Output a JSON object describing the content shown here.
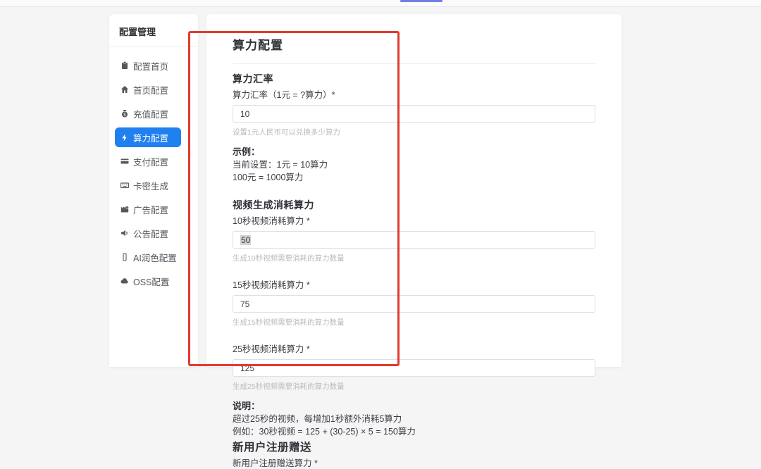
{
  "topbar": {
    "accent_color": "#7280e4"
  },
  "sidebar": {
    "title": "配置管理",
    "active_color": "#2080f0",
    "items": [
      {
        "icon": "clipboard-icon",
        "label": "配置首页",
        "active": false
      },
      {
        "icon": "home-icon",
        "label": "首页配置",
        "active": false
      },
      {
        "icon": "coin-icon",
        "label": "充值配置",
        "active": false
      },
      {
        "icon": "lightning-icon",
        "label": "算力配置",
        "active": true
      },
      {
        "icon": "credit-card-icon",
        "label": "支付配置",
        "active": false
      },
      {
        "icon": "keyboard-icon",
        "label": "卡密生成",
        "active": false
      },
      {
        "icon": "clapperboard-icon",
        "label": "广告配置",
        "active": false
      },
      {
        "icon": "speaker-icon",
        "label": "公告配置",
        "active": false
      },
      {
        "icon": "pen-icon",
        "label": "AI润色配置",
        "active": false
      },
      {
        "icon": "cloud-icon",
        "label": "OSS配置",
        "active": false
      }
    ]
  },
  "main": {
    "title": "算力配置",
    "rate_section": "算力汇率",
    "rate_label": "算力汇率（1元 = ?算力）*",
    "rate_value": "10",
    "rate_helper": "设置1元人民币可以兑换多少算力",
    "example_title": "示例：",
    "example_line1": "当前设置：1元 = 10算力",
    "example_line2": "100元 = 1000算力",
    "video_section": "视频生成消耗算力",
    "v10_label": "10秒视频消耗算力 *",
    "v10_value": "50",
    "v10_helper": "生成10秒视频需要消耗的算力数量",
    "v15_label": "15秒视频消耗算力 *",
    "v15_value": "75",
    "v15_helper": "生成15秒视频需要消耗的算力数量",
    "v25_label": "25秒视频消耗算力 *",
    "v25_value": "125",
    "v25_helper": "生成25秒视频需要消耗的算力数量",
    "note_title": "说明：",
    "note_line1": "超过25秒的视频，每增加1秒额外消耗5算力",
    "note_line2": "例如：30秒视频 = 125 + (30-25) × 5 = 150算力",
    "newuser_section": "新用户注册赠送",
    "newuser_label": "新用户注册赠送算力 *"
  },
  "annotation": {
    "color": "#e23a30"
  }
}
